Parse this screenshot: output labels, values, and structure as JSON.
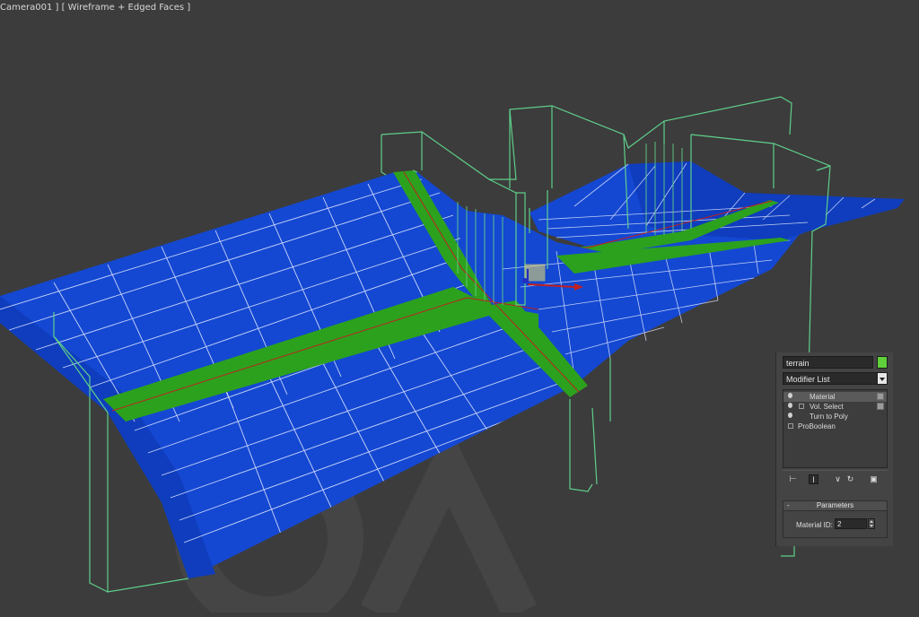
{
  "viewport": {
    "label": "Camera001 ] [ Wireframe + Edged Faces ]"
  },
  "colors": {
    "background": "#3c3c3c",
    "terrain": "#1448d2",
    "road": "#2ca11e",
    "bbox": "#5fcf8a",
    "wire": "#dfe6ff",
    "object_color": "#5fcf3a"
  },
  "modify_panel": {
    "object_name": "terrain",
    "modifier_list_label": "Modifier List",
    "stack": [
      {
        "label": "Material",
        "selected": true
      },
      {
        "label": "Vol. Select"
      },
      {
        "label": "Turn to Poly"
      },
      {
        "label": "ProBoolean"
      }
    ],
    "toolbar_icons": [
      "pin-stack-icon",
      "show-end-result-icon",
      "make-unique-icon",
      "remove-modifier-icon",
      "configure-sets-icon"
    ],
    "parameters": {
      "title": "Parameters",
      "collapse_symbol": "-",
      "material_id_label": "Material ID:",
      "material_id_value": "2"
    }
  }
}
